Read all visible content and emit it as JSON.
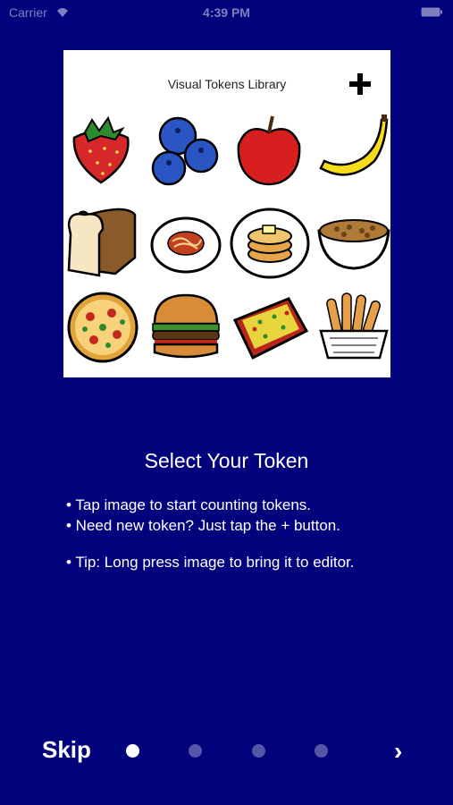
{
  "status_bar": {
    "carrier": "Carrier",
    "time": "4:39 PM",
    "wifi_icon": "wifi-icon",
    "battery_icon": "battery-icon"
  },
  "preview": {
    "title": "Visual Tokens Library",
    "add_icon": "plus-icon",
    "tokens": [
      {
        "name": "strawberry"
      },
      {
        "name": "blueberries"
      },
      {
        "name": "apple"
      },
      {
        "name": "banana"
      },
      {
        "name": "bread"
      },
      {
        "name": "spaghetti"
      },
      {
        "name": "pancakes"
      },
      {
        "name": "cereal"
      },
      {
        "name": "pizza"
      },
      {
        "name": "hamburger"
      },
      {
        "name": "lasagna"
      },
      {
        "name": "chicken-tenders"
      }
    ]
  },
  "heading": "Select Your Token",
  "bullets": [
    "• Tap image to start counting tokens.",
    "• Need new token? Just tap the + button."
  ],
  "tip": "• Tip: Long press image to bring it to editor.",
  "footer": {
    "skip_label": "Skip",
    "page_count": 4,
    "current_page": 1,
    "next_label": "›"
  },
  "colors": {
    "background": "#02037c",
    "text": "#ffffff",
    "inactive_dot": "#5656a8"
  }
}
